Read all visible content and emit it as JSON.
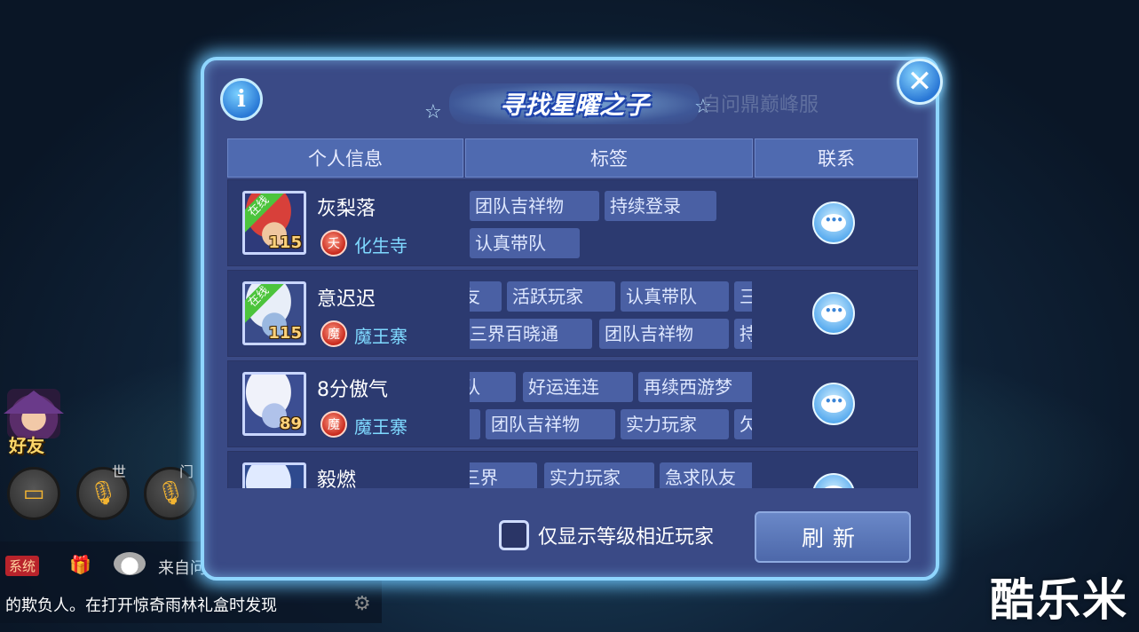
{
  "hud": {
    "friend_label": "好友",
    "world_tag": "世",
    "team_tag": "门",
    "icons": [
      "chat-icon",
      "mic-icon",
      "mic-icon"
    ]
  },
  "chat": {
    "badge": "系统",
    "line1": "来自问鼎巅峰服务器",
    "line2": "的欺负人。在打开惊奇雨林礼盒时发现"
  },
  "watermark": "酷乐米",
  "dialog": {
    "title": "寻找星曜之子",
    "server_hint": "自问鼎巅峰服",
    "info_label": "i",
    "close_label": "✕",
    "headers": [
      "个人信息",
      "标签",
      "联系"
    ],
    "players": [
      {
        "name": "灰梨落",
        "level": "115",
        "online": "在线",
        "sect": "化生寺",
        "sect_glyph": "夭",
        "portrait": [
          "#d8403a",
          "#f0c7a0",
          "#2e3a7a"
        ],
        "tags": [
          "团队吉祥物",
          "持续登录",
          "认真带队"
        ]
      },
      {
        "name": "意迟迟",
        "level": "115",
        "online": "在线",
        "sect": "魔王寨",
        "sect_glyph": "魔",
        "portrait": [
          "#e8eef8",
          "#9ab8e0",
          "#3a4c8a"
        ],
        "tags": [
          "友",
          "活跃玩家",
          "认真带队",
          "三",
          "三界百晓通",
          "团队吉祥物",
          "持"
        ]
      },
      {
        "name": "8分傲气",
        "level": "89",
        "online": "",
        "sect": "魔王寨",
        "sect_glyph": "魔",
        "portrait": [
          "#f0f2fa",
          "#b0c2ea",
          "#3c4e92"
        ],
        "tags": [
          "带队",
          "好运连连",
          "再续西游梦",
          "物",
          "团队吉祥物",
          "实力玩家",
          "欠"
        ]
      },
      {
        "name": "毅燃",
        "level": "",
        "online": "",
        "sect": "",
        "sect_glyph": "",
        "portrait": [
          "#e0eaff",
          "#6ea0e0",
          "#2e4a8e"
        ],
        "tags": [
          "战三界",
          "实力玩家",
          "急求队友"
        ]
      }
    ],
    "filter_label": "仅显示等级相近玩家",
    "filter_checked": false,
    "refresh_label": "刷新"
  }
}
